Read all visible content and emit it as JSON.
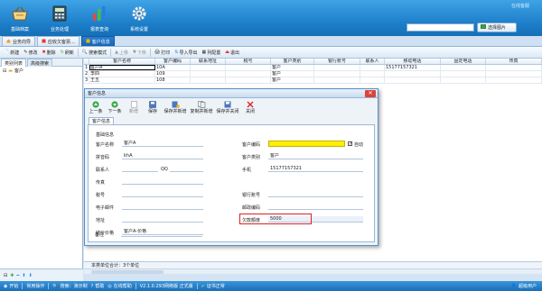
{
  "app": {
    "header_right": "在线客服",
    "search_placeholder": "",
    "search_button": "选择图片"
  },
  "topnav": [
    {
      "label": "基础档案",
      "icon": "basket-icon"
    },
    {
      "label": "业务处理",
      "icon": "calculator-icon"
    },
    {
      "label": "报表查询",
      "icon": "barchart-icon"
    },
    {
      "label": "系统设置",
      "icon": "gear-icon"
    }
  ],
  "doc_tabs": [
    {
      "label": "业务向导"
    },
    {
      "label": "应收欠客票..."
    },
    {
      "label": "客户信息"
    }
  ],
  "toolbar": {
    "new": "新建",
    "edit": "修改",
    "delete": "删除",
    "refresh": "刷新",
    "search_mode": "搜索模式",
    "prev": "上移",
    "next": "下移",
    "print": "打印",
    "import_export": "导入导出",
    "columns": "列配置",
    "exit": "退出"
  },
  "left_panel": {
    "tabs": [
      "类别列表",
      "高级搜索"
    ],
    "tree_root": "客户"
  },
  "grid": {
    "columns": [
      "客户名称",
      "客户编码",
      "联系地址",
      "税号",
      "客户类别",
      "银行账号",
      "联系人",
      "移动电话",
      "固定电话",
      "传真"
    ],
    "rows": [
      {
        "n": "1",
        "name": "客户A",
        "code": "10A",
        "addr": "",
        "tax": "",
        "cat": "客户",
        "bank": "",
        "contact": "",
        "mobile": "15177157321",
        "phone": "",
        "fax": ""
      },
      {
        "n": "2",
        "name": "李四",
        "code": "109",
        "addr": "",
        "tax": "",
        "cat": "客户",
        "bank": "",
        "contact": "",
        "mobile": "",
        "phone": "",
        "fax": ""
      },
      {
        "n": "3",
        "name": "王五",
        "code": "108",
        "addr": "",
        "tax": "",
        "cat": "客户",
        "bank": "",
        "contact": "",
        "mobile": "",
        "phone": "",
        "fax": ""
      }
    ],
    "summary": "本类单位合计：3个单位"
  },
  "dialog": {
    "title": "客户信息",
    "toolbar": {
      "prev": "上一条",
      "next": "下一条",
      "new": "新增",
      "save": "保存",
      "save_new": "保存并新增",
      "copy_new": "复制并新增",
      "save_close": "保存并关闭",
      "close": "关闭"
    },
    "tab": "客户信息",
    "group": "基础信息",
    "fields": {
      "name_label": "客户名称",
      "name_value": "客户A",
      "code_label": "客户编码",
      "code_value": "",
      "auto_label": "自动",
      "pinyin_label": "拼音码",
      "pinyin_value": "khA",
      "category_label": "客户类别",
      "category_value": "客户",
      "contact_label": "联系人",
      "contact_value": "",
      "qq_label": "QQ",
      "qq_value": "",
      "mobile_label": "手机",
      "mobile_value": "15177157321",
      "fax_label": "传真",
      "fax_value": "",
      "tax_label": "税号",
      "tax_value": "",
      "bank_label": "银行账号",
      "bank_value": "",
      "email_label": "电子邮件",
      "email_value": "",
      "postcode_label": "邮政编码",
      "postcode_value": "",
      "addr_label": "地址",
      "addr_value": "",
      "credit_label": "欠款额度",
      "credit_value": "5000",
      "price_label": "结价价格",
      "price_value": "客户A-价格",
      "note_label": "备注",
      "note_value": ""
    }
  },
  "statusbar": {
    "start": "开始",
    "shortcut": "常用操作",
    "search": "搜索：演示制",
    "help": "帮助",
    "online": "在线帮助",
    "version": "V2.1.0.293网络版 正式版",
    "cert": "证书正常",
    "user": "超级用户"
  },
  "colors": {
    "accent": "#1b7cc7",
    "highlight_field": "#ffee00",
    "red_box": "#dd2222"
  }
}
